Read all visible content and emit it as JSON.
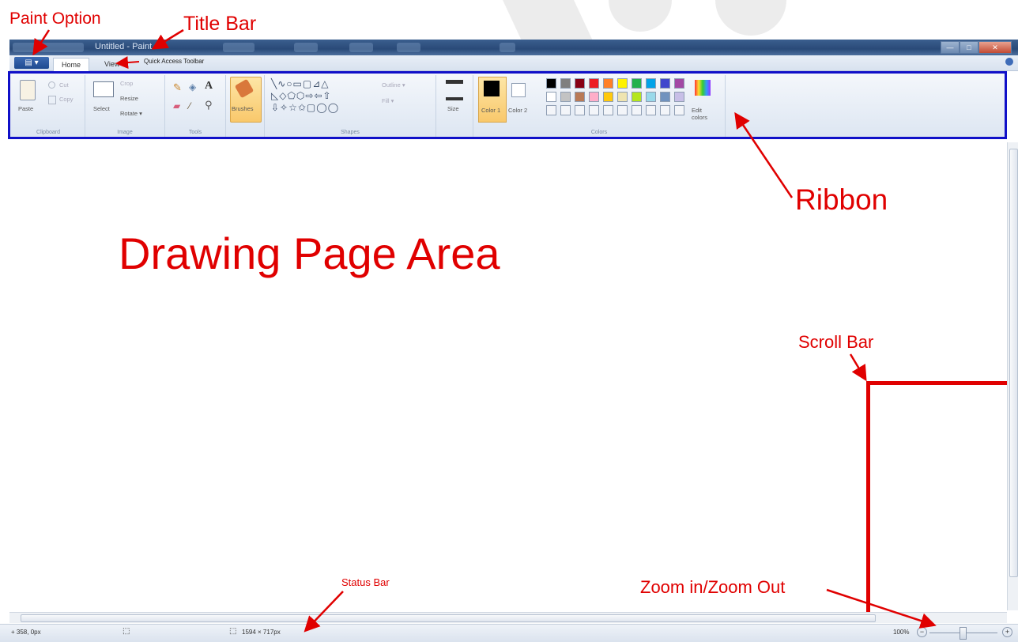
{
  "window": {
    "title": "Untitled - Paint",
    "controls": [
      "—",
      "□",
      "✕"
    ]
  },
  "tabs": {
    "paint_menu": "▤ ▾",
    "home": "Home",
    "view": "View",
    "quick_access": "Quick Access Toolbar"
  },
  "ribbon": {
    "clipboard": {
      "paste": "Paste",
      "cut": "Cut",
      "copy": "Copy",
      "label": "Clipboard"
    },
    "image": {
      "select": "Select",
      "crop": "Crop",
      "resize": "Resize",
      "rotate": "Rotate ▾",
      "label": "Image"
    },
    "tools": {
      "label": "Tools"
    },
    "brushes": {
      "label": "Brushes"
    },
    "shapes": {
      "outline": "Outline ▾",
      "fill": "Fill ▾",
      "label": "Shapes"
    },
    "size": {
      "label": "Size"
    },
    "colors": {
      "color1": "Color 1",
      "color2": "Color 2",
      "edit": "Edit colors",
      "label": "Colors",
      "row1": [
        "#000000",
        "#7f7f7f",
        "#880015",
        "#ed1c24",
        "#ff7f27",
        "#fff200",
        "#22b14c",
        "#00a2e8",
        "#3f48cc",
        "#a349a4"
      ],
      "row2": [
        "#ffffff",
        "#c3c3c3",
        "#b97a57",
        "#ffaec9",
        "#ffc90e",
        "#efe4b0",
        "#b5e61d",
        "#99d9ea",
        "#7092be",
        "#c8bfe7"
      ]
    }
  },
  "status": {
    "cursor": "+ 358, 0px",
    "selection": "",
    "size": "1594 × 717px",
    "zoom": "100%"
  },
  "annotations": {
    "paint_option": "Paint Option",
    "title_bar": "Title Bar",
    "ribbon": "Ribbon",
    "drawing_area": "Drawing Page Area",
    "scroll_bar": "Scroll Bar",
    "status_bar": "Status Bar",
    "zoom": "Zoom in/Zoom Out"
  },
  "colors": {
    "annotation": "#e00000",
    "ribbon_border": "#1010c8"
  }
}
